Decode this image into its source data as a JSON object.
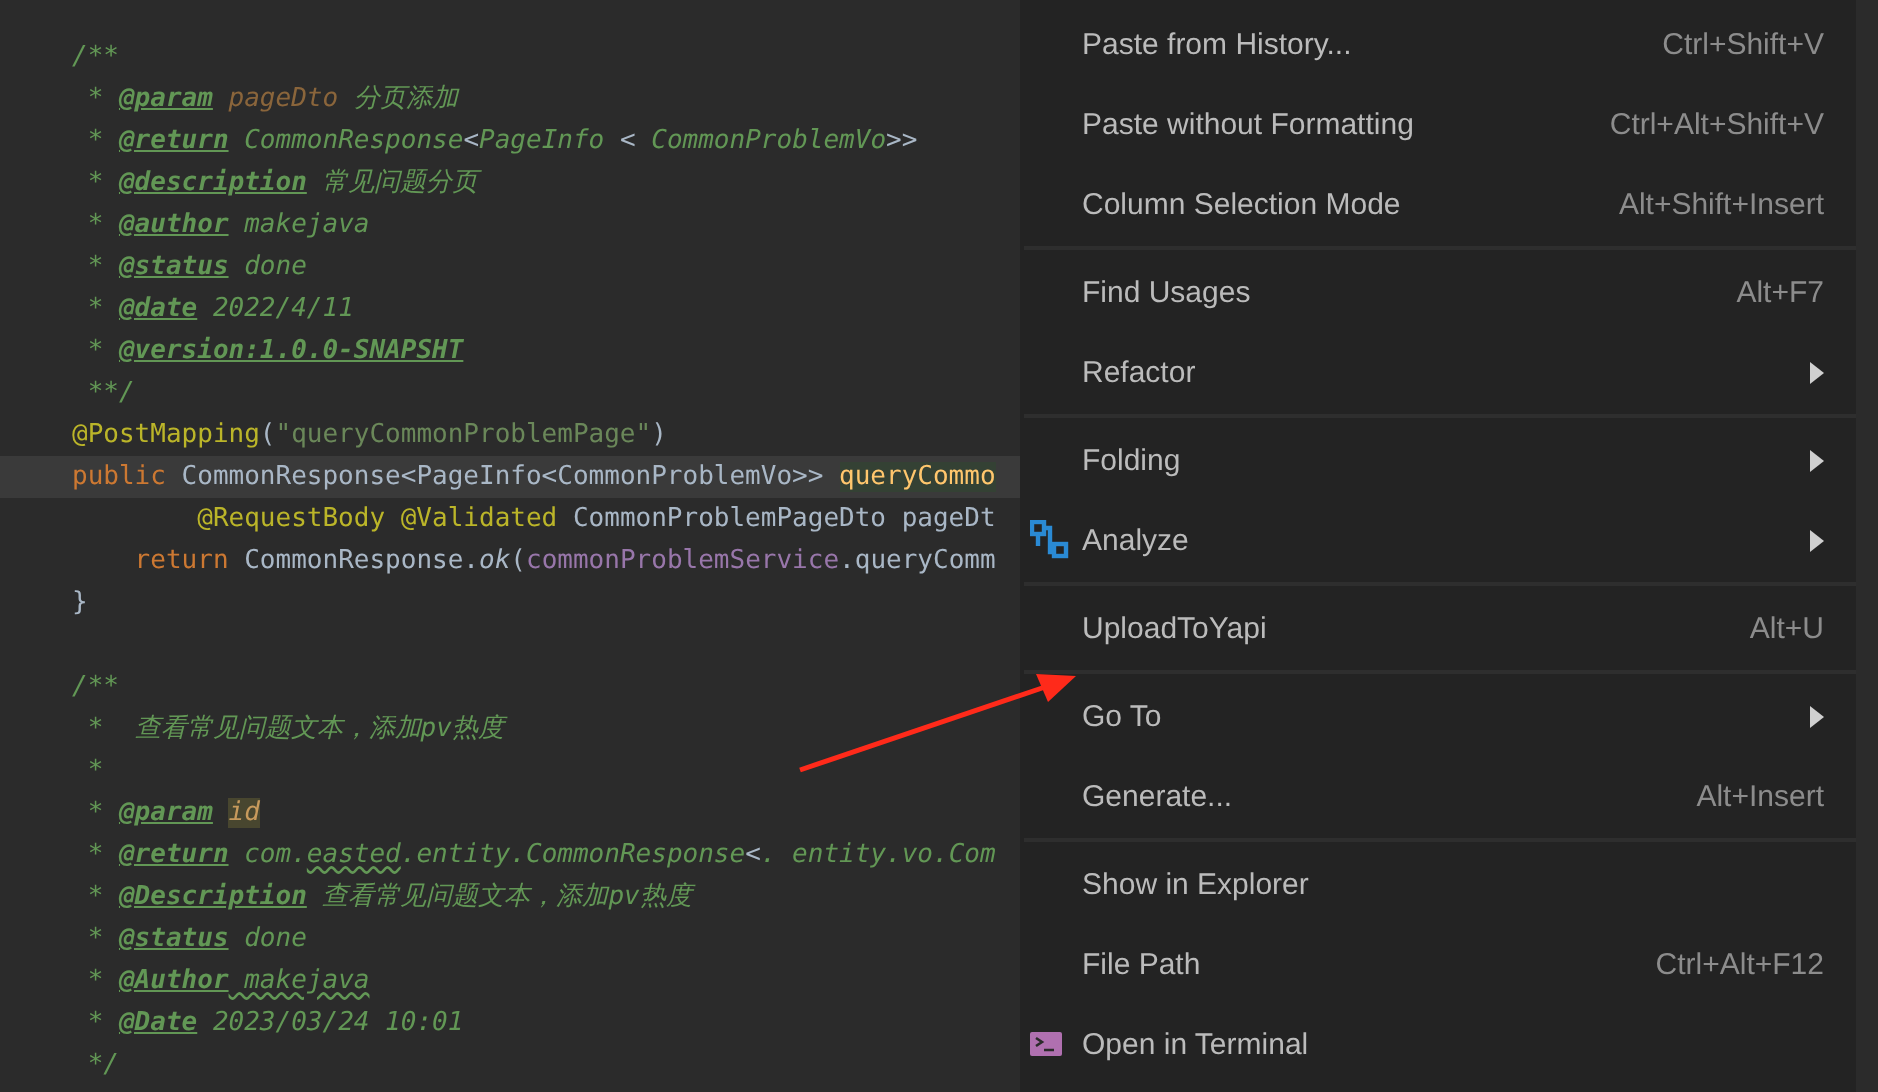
{
  "editor": {
    "lines": [
      {
        "current": false,
        "tokens": [
          {
            "kind": "comment",
            "text": "/**"
          }
        ]
      },
      {
        "current": false,
        "tokens": [
          {
            "kind": "comment",
            "text": " * "
          },
          {
            "kind": "tag",
            "text": "@param"
          },
          {
            "kind": "param",
            "text": " pageDto"
          },
          {
            "kind": "comment",
            "text": " 分页添加"
          }
        ]
      },
      {
        "current": false,
        "tokens": [
          {
            "kind": "comment",
            "text": " * "
          },
          {
            "kind": "tag",
            "text": "@return"
          },
          {
            "kind": "comment",
            "text": " CommonResponse"
          },
          {
            "kind": "plain",
            "text": "<"
          },
          {
            "kind": "comment",
            "text": "PageInfo "
          },
          {
            "kind": "plain",
            "text": "<"
          },
          {
            "kind": "comment",
            "text": " CommonProblemVo"
          },
          {
            "kind": "plain",
            "text": ">>"
          }
        ]
      },
      {
        "current": false,
        "tokens": [
          {
            "kind": "comment",
            "text": " * "
          },
          {
            "kind": "tag",
            "text": "@description"
          },
          {
            "kind": "comment",
            "text": " 常见问题分页"
          }
        ]
      },
      {
        "current": false,
        "tokens": [
          {
            "kind": "comment",
            "text": " * "
          },
          {
            "kind": "tag",
            "text": "@author"
          },
          {
            "kind": "comment",
            "text": " makejava"
          }
        ]
      },
      {
        "current": false,
        "tokens": [
          {
            "kind": "comment",
            "text": " * "
          },
          {
            "kind": "tag",
            "text": "@status"
          },
          {
            "kind": "comment",
            "text": " done"
          }
        ]
      },
      {
        "current": false,
        "tokens": [
          {
            "kind": "comment",
            "text": " * "
          },
          {
            "kind": "tag",
            "text": "@date"
          },
          {
            "kind": "comment",
            "text": " 2022/4/11"
          }
        ]
      },
      {
        "current": false,
        "tokens": [
          {
            "kind": "comment",
            "text": " * "
          },
          {
            "kind": "tag",
            "text": "@version:1.0.0-SNAPSHT"
          }
        ]
      },
      {
        "current": false,
        "tokens": [
          {
            "kind": "comment",
            "text": " **/"
          }
        ]
      },
      {
        "current": false,
        "tokens": [
          {
            "kind": "annotation",
            "text": "@PostMapping"
          },
          {
            "kind": "plain",
            "text": "("
          },
          {
            "kind": "string",
            "text": "\"queryCommonProblemPage\""
          },
          {
            "kind": "plain",
            "text": ")"
          }
        ]
      },
      {
        "current": true,
        "tokens": [
          {
            "kind": "keyword",
            "text": "public"
          },
          {
            "kind": "plain",
            "text": " CommonResponse<PageInfo<CommonProblemVo>> "
          },
          {
            "kind": "method",
            "text": "queryCommo"
          }
        ]
      },
      {
        "current": false,
        "tokens": [
          {
            "kind": "annotation",
            "text": "        @RequestBody @Validated"
          },
          {
            "kind": "plain",
            "text": " CommonProblemPageDto pageDt"
          }
        ]
      },
      {
        "current": false,
        "tokens": [
          {
            "kind": "keyword",
            "text": "    return"
          },
          {
            "kind": "plain",
            "text": " CommonResponse."
          },
          {
            "kind": "italic",
            "text": "ok"
          },
          {
            "kind": "plain",
            "text": "("
          },
          {
            "kind": "field",
            "text": "commonProblemService"
          },
          {
            "kind": "plain",
            "text": ".queryComm"
          }
        ]
      },
      {
        "current": false,
        "tokens": [
          {
            "kind": "plain",
            "text": "}"
          }
        ]
      },
      {
        "current": false
      },
      {
        "current": false,
        "tokens": [
          {
            "kind": "comment",
            "text": "/**"
          }
        ]
      },
      {
        "current": false,
        "tokens": [
          {
            "kind": "comment",
            "text": " *  查看常见问题文本，添加pv热度"
          }
        ]
      },
      {
        "current": false,
        "tokens": [
          {
            "kind": "comment",
            "text": " *"
          }
        ]
      },
      {
        "current": false,
        "tokens": [
          {
            "kind": "comment",
            "text": " * "
          },
          {
            "kind": "tag",
            "text": "@param"
          },
          {
            "kind": "unused",
            "text": "id"
          }
        ]
      },
      {
        "current": false,
        "tokens": [
          {
            "kind": "comment",
            "text": " * "
          },
          {
            "kind": "tag",
            "text": "@return"
          },
          {
            "kind": "comment",
            "text": " com."
          },
          {
            "kind": "typo",
            "text": "easted"
          },
          {
            "kind": "comment",
            "text": ".entity.CommonResponse"
          },
          {
            "kind": "plain",
            "text": "<"
          },
          {
            "kind": "comment",
            "text": ". entity.vo.Com"
          }
        ]
      },
      {
        "current": false,
        "tokens": [
          {
            "kind": "comment",
            "text": " * "
          },
          {
            "kind": "tag",
            "text": "@Description"
          },
          {
            "kind": "comment",
            "text": " 查看常见问题文本，添加pv热度"
          }
        ]
      },
      {
        "current": false,
        "tokens": [
          {
            "kind": "comment",
            "text": " * "
          },
          {
            "kind": "tag",
            "text": "@status"
          },
          {
            "kind": "comment",
            "text": " done"
          }
        ]
      },
      {
        "current": false,
        "tokens": [
          {
            "kind": "comment",
            "text": " * "
          },
          {
            "kind": "tag",
            "text": "@Author"
          },
          {
            "kind": "typo",
            "text": " makejava"
          }
        ]
      },
      {
        "current": false,
        "tokens": [
          {
            "kind": "comment",
            "text": " * "
          },
          {
            "kind": "tag",
            "text": "@Date"
          },
          {
            "kind": "comment",
            "text": " 2023/03/24 10:01"
          }
        ]
      },
      {
        "current": false,
        "tokens": [
          {
            "kind": "comment",
            "text": " */"
          }
        ]
      }
    ]
  },
  "context_menu": {
    "groups": [
      [
        {
          "label": "Paste from History...",
          "shortcut": "Ctrl+Shift+V",
          "submenu": false
        },
        {
          "label": "Paste without Formatting",
          "shortcut": "Ctrl+Alt+Shift+V",
          "submenu": false
        },
        {
          "label": "Column Selection Mode",
          "shortcut": "Alt+Shift+Insert",
          "submenu": false
        }
      ],
      [
        {
          "label": "Find Usages",
          "shortcut": "Alt+F7",
          "submenu": false
        },
        {
          "label": "Refactor",
          "submenu": true
        }
      ],
      [
        {
          "label": "Folding",
          "submenu": true
        },
        {
          "label": "Analyze",
          "submenu": true
        }
      ],
      [
        {
          "label": "UploadToYapi",
          "shortcut": "Alt+U",
          "submenu": false
        }
      ],
      [
        {
          "label": "Go To",
          "submenu": true
        },
        {
          "label": "Generate...",
          "shortcut": "Alt+Insert",
          "submenu": false
        }
      ],
      [
        {
          "label": "Show in Explorer",
          "submenu": false
        },
        {
          "label": "File Path",
          "shortcut": "Ctrl+Alt+F12",
          "submenu": false
        },
        {
          "label": "Open in Terminal",
          "submenu": false
        }
      ]
    ]
  }
}
